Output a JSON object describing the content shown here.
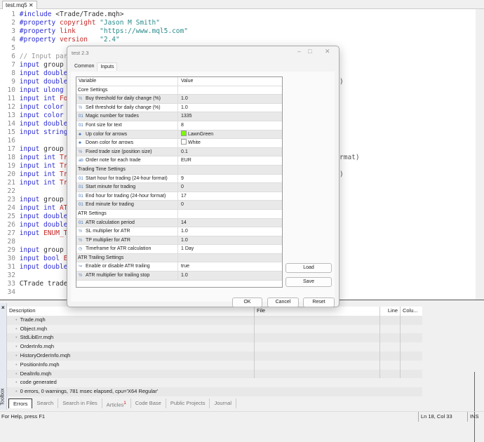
{
  "tab": {
    "file": "test.mq5",
    "close": "✕"
  },
  "code": [
    {
      "n": "1",
      "seg": [
        [
          "#include",
          "kw"
        ],
        [
          " <Trade/Trade.mqh>",
          "pl"
        ]
      ]
    },
    {
      "n": "2",
      "seg": [
        [
          "#property",
          "kw"
        ],
        [
          " copyright ",
          "id"
        ],
        [
          "\"Jason M Smith\"",
          "st"
        ]
      ]
    },
    {
      "n": "3",
      "seg": [
        [
          "#property",
          "kw"
        ],
        [
          " link      ",
          "id"
        ],
        [
          "\"https://www.mql5.com\"",
          "st"
        ]
      ]
    },
    {
      "n": "4",
      "seg": [
        [
          "#property",
          "kw"
        ],
        [
          " version   ",
          "id"
        ],
        [
          "\"2.4\"",
          "st"
        ]
      ]
    },
    {
      "n": "5",
      "seg": []
    },
    {
      "n": "6",
      "seg": [
        [
          "// Input para",
          "cm"
        ]
      ]
    },
    {
      "n": "7",
      "seg": [
        [
          "input",
          "kw"
        ],
        [
          " group \"",
          "pl"
        ]
      ]
    },
    {
      "n": "8",
      "seg": [
        [
          "input double",
          "kw"
        ]
      ]
    },
    {
      "n": "9",
      "seg": [
        [
          "input double",
          "kw"
        ]
      ],
      "tail": ")"
    },
    {
      "n": "10",
      "seg": [
        [
          "input ulong ",
          "kw"
        ],
        [
          "M",
          "id"
        ]
      ]
    },
    {
      "n": "11",
      "seg": [
        [
          "input int ",
          "kw"
        ],
        [
          "For",
          "id"
        ]
      ]
    },
    {
      "n": "12",
      "seg": [
        [
          "input color ",
          "kw"
        ],
        [
          "U",
          "id"
        ]
      ]
    },
    {
      "n": "13",
      "seg": [
        [
          "input color ",
          "kw"
        ],
        [
          "D",
          "id"
        ]
      ]
    },
    {
      "n": "14",
      "seg": [
        [
          "input double",
          "kw"
        ]
      ]
    },
    {
      "n": "15",
      "seg": [
        [
          "input string",
          "kw"
        ]
      ]
    },
    {
      "n": "16",
      "seg": []
    },
    {
      "n": "17",
      "seg": [
        [
          "input",
          "kw"
        ],
        [
          " group \"",
          "pl"
        ]
      ]
    },
    {
      "n": "18",
      "seg": [
        [
          "input int ",
          "kw"
        ],
        [
          "Tra",
          "id"
        ]
      ],
      "tail": "rmat)"
    },
    {
      "n": "19",
      "seg": [
        [
          "input int ",
          "kw"
        ],
        [
          "Tra",
          "id"
        ]
      ]
    },
    {
      "n": "20",
      "seg": [
        [
          "input int ",
          "kw"
        ],
        [
          "Tra",
          "id"
        ]
      ],
      "tail": ")"
    },
    {
      "n": "21",
      "seg": [
        [
          "input int ",
          "kw"
        ],
        [
          "Tra",
          "id"
        ]
      ]
    },
    {
      "n": "22",
      "seg": []
    },
    {
      "n": "23",
      "seg": [
        [
          "input",
          "kw"
        ],
        [
          " group \"",
          "pl"
        ]
      ]
    },
    {
      "n": "24",
      "seg": [
        [
          "input int ",
          "kw"
        ],
        [
          "ATR",
          "id"
        ]
      ]
    },
    {
      "n": "25",
      "seg": [
        [
          "input double",
          "kw"
        ]
      ]
    },
    {
      "n": "26",
      "seg": [
        [
          "input double",
          "kw"
        ]
      ]
    },
    {
      "n": "27",
      "seg": [
        [
          "input ",
          "kw"
        ],
        [
          "ENUM_TI",
          "id"
        ]
      ]
    },
    {
      "n": "28",
      "seg": []
    },
    {
      "n": "29",
      "seg": [
        [
          "input",
          "kw"
        ],
        [
          " group \"",
          "pl"
        ]
      ]
    },
    {
      "n": "30",
      "seg": [
        [
          "input bool ",
          "kw"
        ],
        [
          "En",
          "id"
        ]
      ]
    },
    {
      "n": "31",
      "seg": [
        [
          "input double",
          "kw"
        ]
      ]
    },
    {
      "n": "32",
      "seg": []
    },
    {
      "n": "33",
      "seg": [
        [
          "CTrade trade;",
          "pl"
        ]
      ]
    },
    {
      "n": "34",
      "seg": []
    }
  ],
  "dialog": {
    "title": "test 2.3",
    "tabs": [
      "Common",
      "Inputs"
    ],
    "headers": [
      "Variable",
      "Value"
    ],
    "rows": [
      {
        "group": "Core Settings"
      },
      {
        "icon": "½",
        "name": "Buy threshold for daily change (%)",
        "value": "1.0"
      },
      {
        "icon": "½",
        "name": "Sell threshold for daily change (%)",
        "value": "1.0"
      },
      {
        "icon": "01",
        "name": "Magic number for trades",
        "value": "1335"
      },
      {
        "icon": "01",
        "name": "Font size for text",
        "value": "8"
      },
      {
        "icon": "♣",
        "name": "Up color for arrows",
        "value": "LawnGreen",
        "swatch": "#7cfc00"
      },
      {
        "icon": "♣",
        "name": "Down color for arrows",
        "value": "White",
        "swatch": "#ffffff"
      },
      {
        "icon": "½",
        "name": "Fixed trade size (position size)",
        "value": "0.1"
      },
      {
        "icon": "ab",
        "name": "Order note for each trade",
        "value": "EUR"
      },
      {
        "group": "Trading Time Settings"
      },
      {
        "icon": "01",
        "name": "Start hour for trading (24-hour format)",
        "value": "9"
      },
      {
        "icon": "01",
        "name": "Start minute for trading",
        "value": "0"
      },
      {
        "icon": "01",
        "name": "End hour for trading (24-hour format)",
        "value": "17"
      },
      {
        "icon": "01",
        "name": "End minute for trading",
        "value": "0"
      },
      {
        "group": "ATR Settings"
      },
      {
        "icon": "01",
        "name": "ATR calculation period",
        "value": "14"
      },
      {
        "icon": "½",
        "name": "SL multiplier for ATR",
        "value": "1.0"
      },
      {
        "icon": "½",
        "name": "TP multiplier for ATR",
        "value": "1.0"
      },
      {
        "icon": "◷",
        "name": "Timeframe for ATR calculation",
        "value": "1 Day"
      },
      {
        "group": "ATR Trailing Settings"
      },
      {
        "icon": "↪",
        "name": "Enable or disable ATR trailing",
        "value": "true"
      },
      {
        "icon": "½",
        "name": "ATR multiplier for trailing stop",
        "value": "1.0"
      }
    ],
    "load": "Load",
    "save": "Save",
    "ok": "OK",
    "cancel": "Cancel",
    "reset": "Reset"
  },
  "toolbox": {
    "label": "Toolbox",
    "close": "×",
    "headers": [
      "Description",
      "File",
      "Line",
      "Colu..."
    ],
    "rows": [
      "Trade.mqh",
      "Object.mqh",
      "StdLibErr.mqh",
      "OrderInfo.mqh",
      "HistoryOrderInfo.mqh",
      "PositionInfo.mqh",
      "DealInfo.mqh",
      "code generated",
      "0 errors, 0 warnings, 781 msec elapsed, cpu='X64 Regular'"
    ],
    "tabs": [
      "Errors",
      "Search",
      "Search in Files",
      "Articles",
      "Code Base",
      "Public Projects",
      "Journal"
    ],
    "articles_badge": "1"
  },
  "status": {
    "help": "For Help, press F1",
    "position": "Ln 18, Col 33",
    "mode": "INS"
  }
}
